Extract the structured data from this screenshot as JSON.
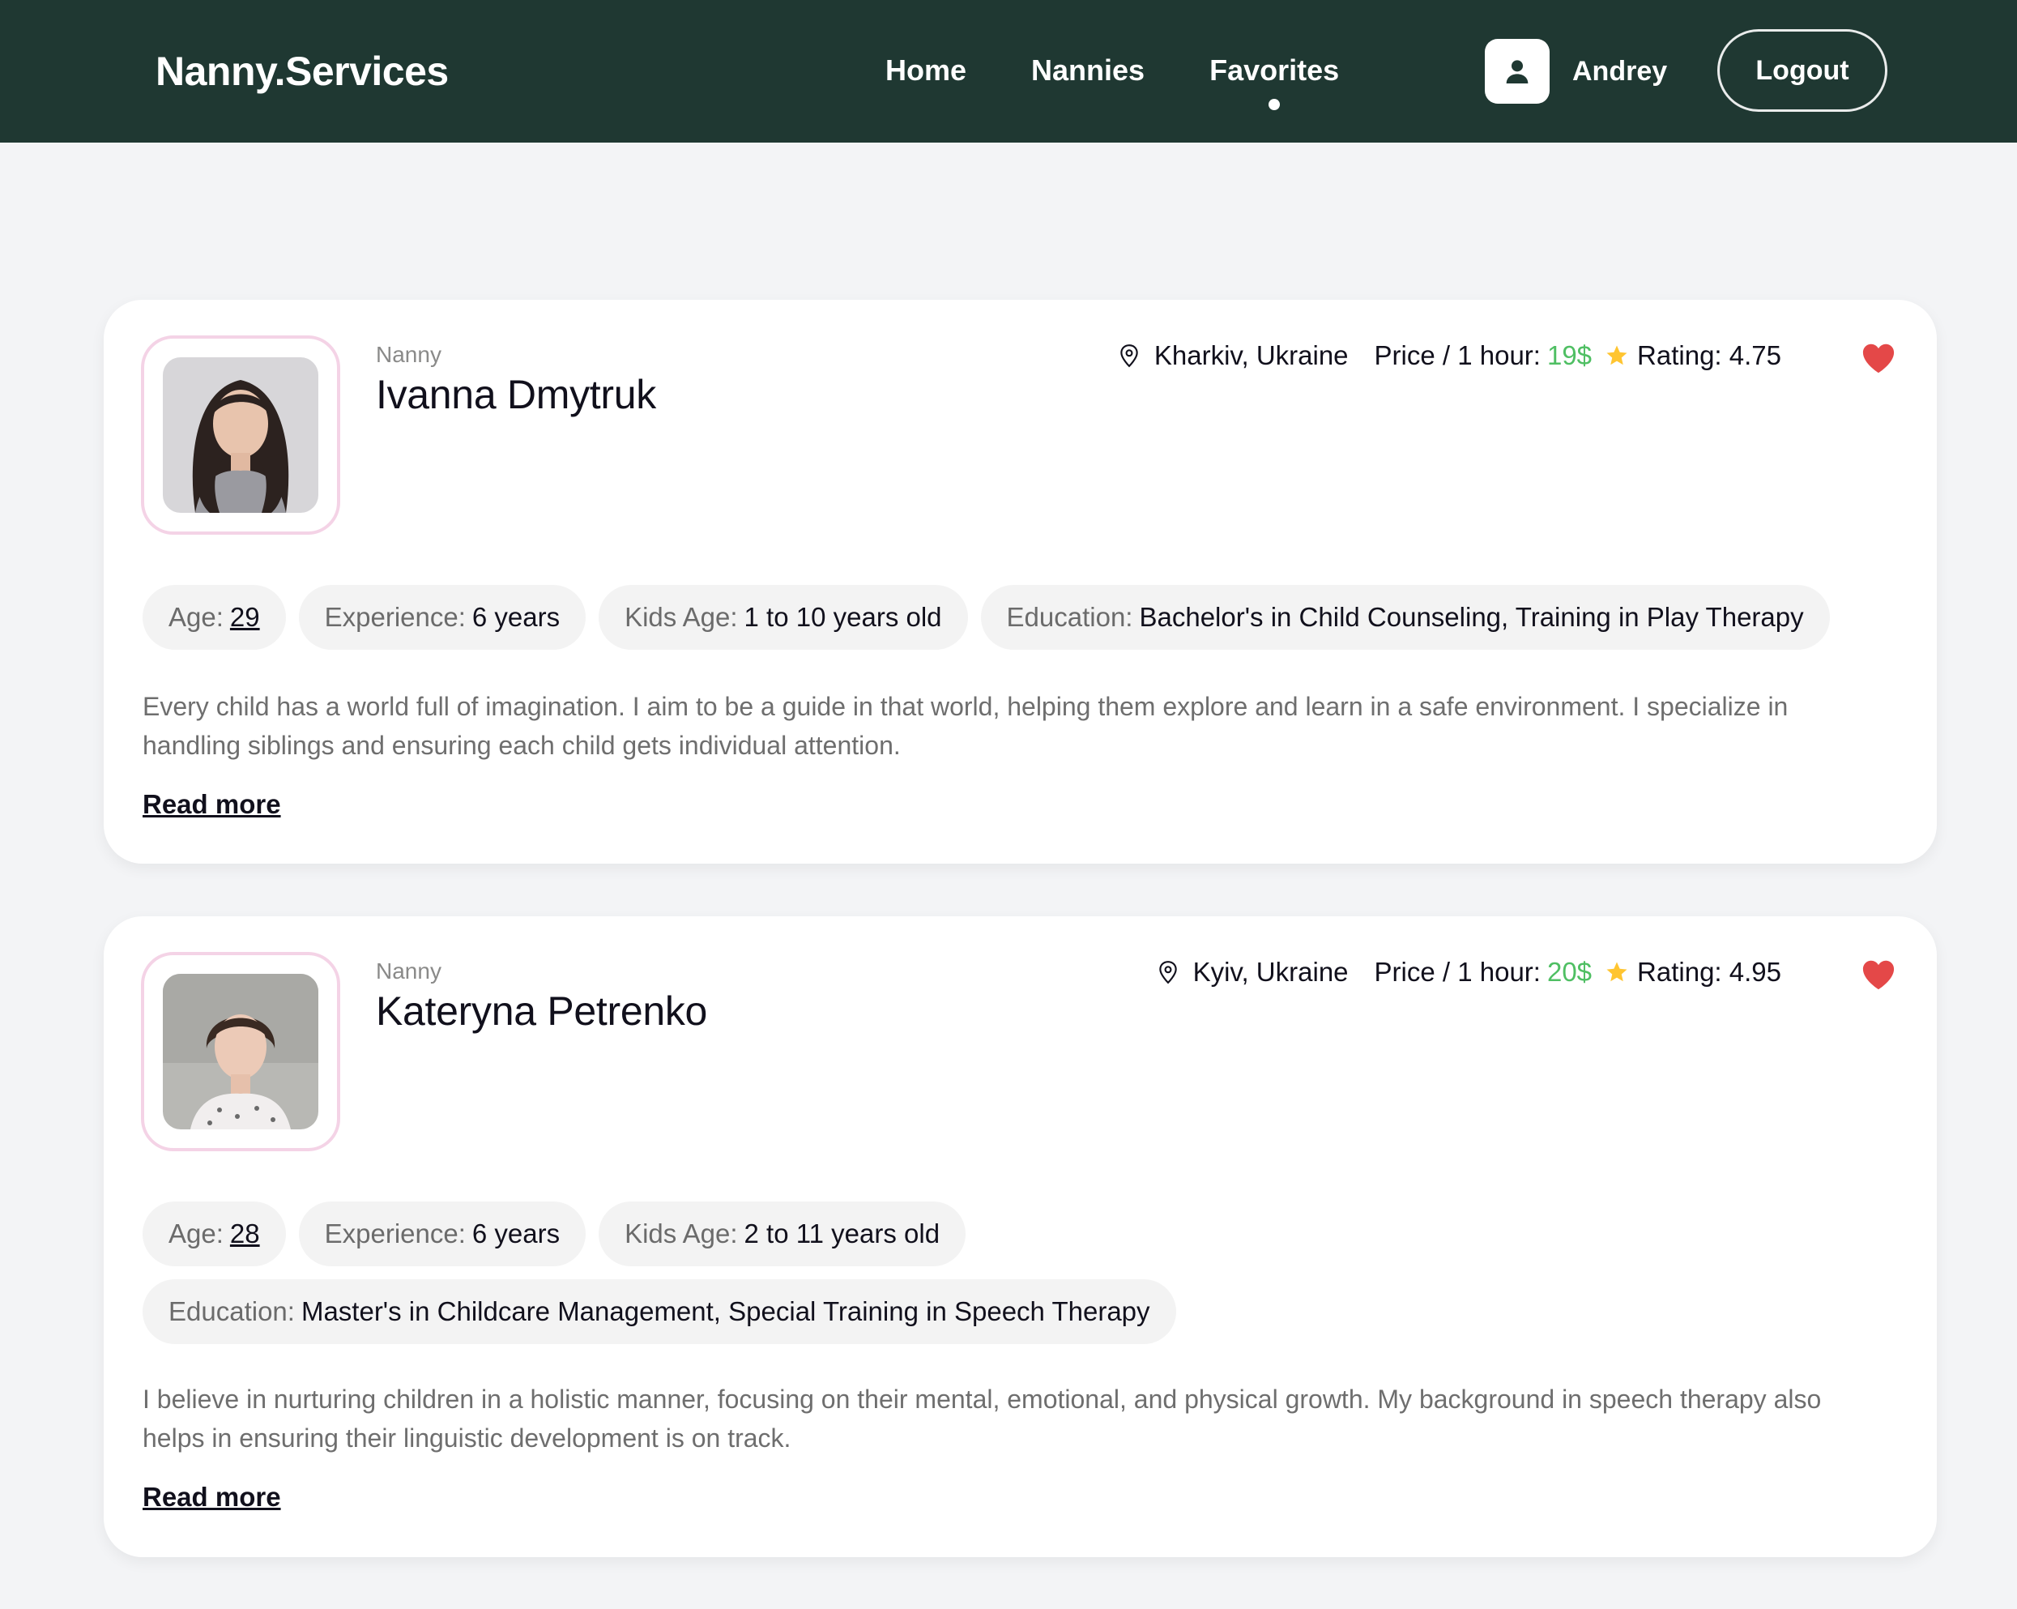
{
  "header": {
    "logo": "Nanny.Services",
    "nav": [
      {
        "label": "Home",
        "active": false
      },
      {
        "label": "Nannies",
        "active": false
      },
      {
        "label": "Favorites",
        "active": true
      }
    ],
    "user_name": "Andrey",
    "logout_label": "Logout"
  },
  "colors": {
    "header_bg": "#1f3832",
    "page_bg": "#f3f4f6",
    "price": "#4fbf63",
    "favorite": "#e44848",
    "star": "#ffc531",
    "photo_border": "#f4d3e6"
  },
  "nannies": [
    {
      "role": "Nanny",
      "name": "Ivanna Dmytruk",
      "location": "Kharkiv, Ukraine",
      "price_label": "Price / 1 hour:",
      "price_value": "19$",
      "rating_label": "Rating: 4.75",
      "favorite": true,
      "age_label": "Age:",
      "age": "29",
      "experience_label": "Experience:",
      "experience": "6 years",
      "kids_age_label": "Kids Age:",
      "kids_age": "1 to 10 years old",
      "education_label": "Education:",
      "education": "Bachelor's in Child Counseling, Training in Play Therapy",
      "description": "Every child has a world full of imagination. I aim to be a guide in that world, helping them explore and learn in a safe environment. I specialize in handling siblings and ensuring each child gets individual attention.",
      "read_more": "Read more"
    },
    {
      "role": "Nanny",
      "name": "Kateryna Petrenko",
      "location": "Kyiv, Ukraine",
      "price_label": "Price / 1 hour:",
      "price_value": "20$",
      "rating_label": "Rating: 4.95",
      "favorite": true,
      "age_label": "Age:",
      "age": "28",
      "experience_label": "Experience:",
      "experience": "6 years",
      "kids_age_label": "Kids Age:",
      "kids_age": "2 to 11 years old",
      "education_label": "Education:",
      "education": "Master's in Childcare Management, Special Training in Speech Therapy",
      "description": "I believe in nurturing children in a holistic manner, focusing on their mental, emotional, and physical growth. My background in speech therapy also helps in ensuring their linguistic development is on track.",
      "read_more": "Read more"
    }
  ]
}
